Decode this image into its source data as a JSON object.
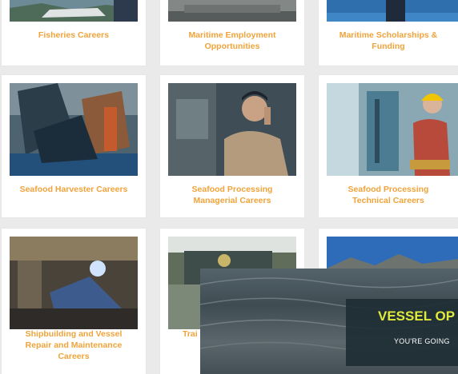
{
  "cards": [
    {
      "title": [
        "Fisheries Careers"
      ]
    },
    {
      "title": [
        "Maritime Employment",
        "Opportunities"
      ]
    },
    {
      "title": [
        "Maritime Scholarships &",
        "Funding"
      ]
    },
    {
      "title": [
        "Seafood Harvester Careers"
      ]
    },
    {
      "title": [
        "Seafood Processing",
        "Managerial Careers"
      ]
    },
    {
      "title": [
        "Seafood Processing",
        "Technical Careers"
      ]
    },
    {
      "title": [
        "Shipbuilding and Vessel",
        "Repair and Maintenance",
        "Careers"
      ]
    },
    {
      "title": [
        "Trai"
      ]
    }
  ],
  "overlay": {
    "title": "VESSEL OP",
    "subtitle": "YOU'RE GOING"
  },
  "colors": {
    "caption": "#f0a33a",
    "overlay_title": "#e1ea3a"
  }
}
